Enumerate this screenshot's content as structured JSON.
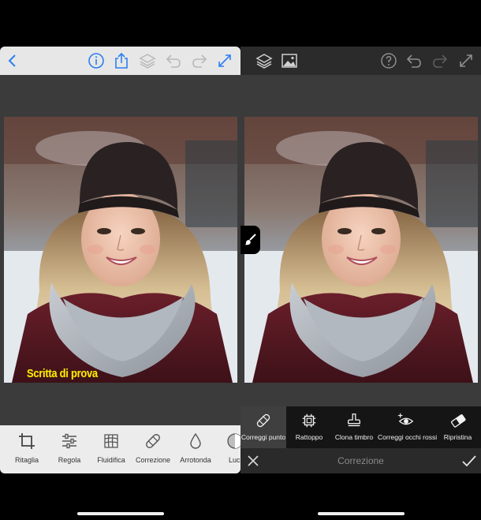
{
  "left": {
    "toolbar_icons": [
      "back-chevron-icon",
      "info-icon",
      "share-icon",
      "layers-icon",
      "undo-icon",
      "redo-icon",
      "expand-icon"
    ],
    "overlay_text": "Scritta di prova",
    "tools": [
      {
        "label": "Ritaglia",
        "icon": "crop-icon"
      },
      {
        "label": "Regola",
        "icon": "sliders-icon"
      },
      {
        "label": "Fluidifica",
        "icon": "liquify-grid-icon"
      },
      {
        "label": "Correzione",
        "icon": "bandage-icon"
      },
      {
        "label": "Arrotonda",
        "icon": "droplet-icon"
      },
      {
        "label": "Luc",
        "icon": "light-icon"
      }
    ]
  },
  "right": {
    "toolbar_icons": [
      "layers-icon",
      "image-icon",
      "help-icon",
      "undo-icon",
      "redo-icon",
      "expand-icon"
    ],
    "tools": [
      {
        "label": "Correggi punto",
        "icon": "bandage-icon",
        "active": true
      },
      {
        "label": "Rattoppo",
        "icon": "patch-icon",
        "active": false
      },
      {
        "label": "Clona timbro",
        "icon": "stamp-icon",
        "active": false
      },
      {
        "label": "Correggi occhi rossi",
        "icon": "red-eye-icon",
        "active": false
      },
      {
        "label": "Ripristina",
        "icon": "eraser-icon",
        "active": false
      }
    ],
    "footer_title": "Correzione",
    "cancel_icon": "close-icon",
    "confirm_icon": "checkmark-icon"
  },
  "colors": {
    "accent": "#2d7ff0",
    "overlay_text": "#ffe800",
    "workspace": "#3b3b3b"
  }
}
